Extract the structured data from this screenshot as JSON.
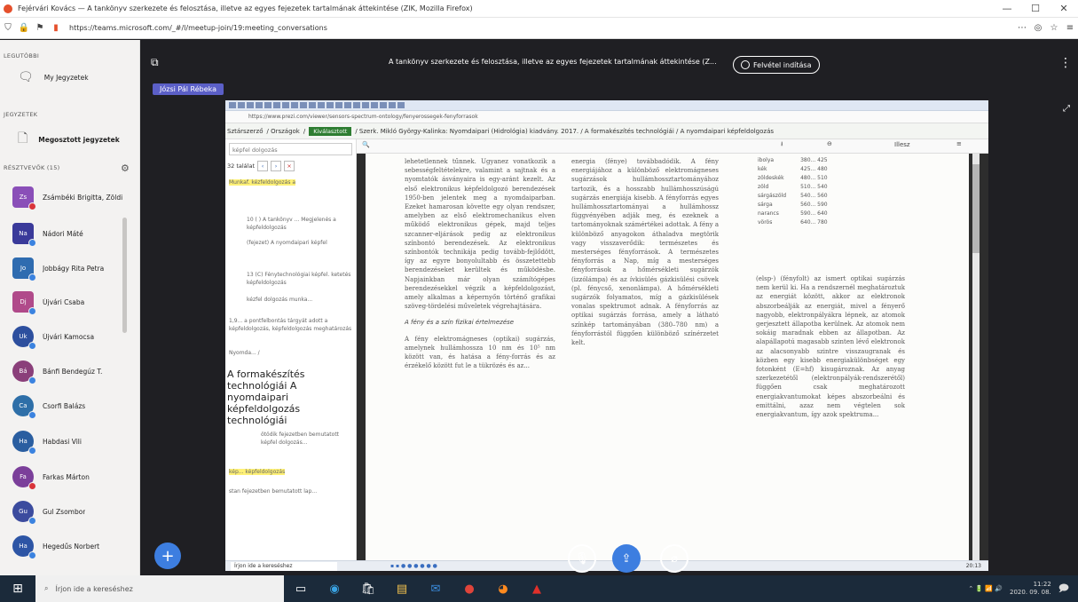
{
  "browser": {
    "window_title": "Fejérvári Kovács — A tankönyv szerkezete és felosztása, illetve az egyes fejezetek tartalmának áttekintése (ZIK, Mozilla Firefox)",
    "url": "https://teams.microsoft.com/_#/l/meetup-join/19:meeting_conversations",
    "controls": [
      "—",
      "☐",
      "✕"
    ]
  },
  "rail": {
    "section_recent": "LEGUTÓBBI",
    "item_recent": "My Jegyzetek",
    "section_meetings": "JEGYZETEK",
    "item_notes": "Megosztott jegyzetek",
    "section_participants": "RÉSZTVEVŐK (15)",
    "people": [
      {
        "initials": "Zs",
        "name": "Zsámbéki Brigitta, Zöldi",
        "color": "#8a4fb8",
        "square": true,
        "dot": "red"
      },
      {
        "initials": "Na",
        "name": "Nádori Máté",
        "color": "#3a3a9a",
        "square": true,
        "dot": "blue"
      },
      {
        "initials": "Jo",
        "name": "Jobbágy Rita Petra",
        "color": "#2f6cb0",
        "square": true,
        "dot": "blue"
      },
      {
        "initials": "Dj",
        "name": "Újvári Csaba",
        "color": "#b04a8a",
        "square": true,
        "dot": "blue"
      },
      {
        "initials": "Uk",
        "name": "Újvári Kamocsa",
        "color": "#2d4f9e",
        "square": false,
        "dot": "blue"
      },
      {
        "initials": "Bá",
        "name": "Bánfi Bendegúz T.",
        "color": "#8a3f7a",
        "square": false,
        "dot": "blue"
      },
      {
        "initials": "Ca",
        "name": "Csorfi Balázs",
        "color": "#2e6fa8",
        "square": false,
        "dot": "blue"
      },
      {
        "initials": "Ha",
        "name": "Habdasi Vili",
        "color": "#2a5ea0",
        "square": false,
        "dot": "blue"
      },
      {
        "initials": "Fa",
        "name": "Farkas Márton",
        "color": "#7b3f9a",
        "square": false,
        "dot": "red"
      },
      {
        "initials": "Gu",
        "name": "Gul Zsombor",
        "color": "#3b4b9e",
        "square": false,
        "dot": "blue"
      },
      {
        "initials": "Ha",
        "name": "Hegedűs Norbert",
        "color": "#2d55a5",
        "square": false,
        "dot": "blue"
      }
    ]
  },
  "meeting": {
    "title": "A tankönyv szerkezete és felosztása, illetve az egyes fejezetek tartalmának áttekintése (Z...",
    "record_label": "Felvétel indítása",
    "presenter": "Józsi Pál Rébeka",
    "menu_icon": "⋮"
  },
  "shared": {
    "tab_url": "https://www.prezi.com/viewer/sensors-spectrum-ontology/fenyerossegek-fenyforrasok",
    "crumbs": [
      "Sztárszerző",
      "/ Országok",
      "/",
      "Kiválasztott",
      "/ Szerk. Mikló György-Kalinka: Nyomdaipari (Hidrológia) kiadvány. 2017. / A formakészítés technológiái / A nyomdaipari képfeldolgozás"
    ],
    "search_placeholder": "képfel dolgozás",
    "side_count": "32 találat",
    "side_results": [
      "Munkaf. kézfeldolgozás a",
      "10 ( ) A tankönyv ... Megjelenés a képfeldolgozás",
      "(fejezet) A nyomdaipari képfel",
      "13 (C) Fénytechnológiai képfel. ketetés képfeldolgozás",
      "kézfel dolgozás munka...",
      "1,9... a pontfelbontás tárgyát adott a képfeldolgozás, képfeldolgozás meghatározás",
      "Nyomda... /"
    ],
    "side_big_title": "A formakészítés technológiái A nyomdaipari képfeldolgozás technológiái",
    "side_bottom": [
      "ötödik fejezetben bemutatott képfel dolgozás...",
      "kép... képfeldolgozás",
      "stan fejezetben bemutatott lap..."
    ],
    "doc_col1": "lehetetlennek tűnnek. Ugyanez vonatkozik a sebességfeltételekre, valamint a sajtnak és a nyomtatók ásványaira is egy-aránt kezelt. Az első elektronikus képfeldolgozó berendezések 1950-ben jelentek meg a nyomdaiparban. Ezeket hamarosan követte egy olyan rendszer, amelyben az első elektromechanikus elven működő elektronikus gépek, majd teljes szcanner-eljárások pedig az elektronikus színbontó berendezések. Az elektronikus színbontók technikája pedig tovább-fejlődött, így az egyre bonyolultabb és összetettebb berendezéseket kerültek és működésbe. Napjainkban már olyan számítógépes berendezésekkel végzik a képfeldolgozást, amely alkalmas a képernyőn történő grafikai szöveg-tördelési műveletek végrehajtására.",
    "doc_col1_heading": "A fény és a szín fizikai értelmezése",
    "doc_col1b": "A fény elektromágneses (optikai) sugárzás, amelynek hullámhossza 10 nm és 10⁵ nm között van, és hatása a fény-forrás és az érzékelő között fut le a tükrözés és az...",
    "doc_col2": "energia (fénye) továbbadódik. A fény energiájához a különböző elektromágneses sugárzások hullámhossztartományához tartozik, és a hosszabb hullámhosszúságú sugárzás energiája kisebb. A fényforrás egyes hullámhossztartományai a hullámhossz függvényében adják meg, és ezeknek a tartományoknak számértékei adottak. A fény a különböző anyagokon áthaladva megtörik vagy visszaverődik: természetes és mesterséges fényforrások. A természetes fényforrás a Nap, míg a mesterséges fényforrások a hőmérsékleti sugárzók (izzólámpa) és az ívkisülés gázkisülési csövek (pl. fénycső, xenonlámpa). A hőmérsékleti sugárzók folyamatos, míg a gázkisülések vonalas spektrumot adnak. A fényforrás az optikai sugárzás forrása, amely a látható színkép tartományában (380–780 nm) a fényforrástól függően különböző színérzetet kelt.",
    "doc_col3": "(elsp-) (fényfolt) az ismert optikai sugárzás nem kerül ki. Ha a rendszernél meghatároztuk az energiát között, akkor az elektronok abszorbeálják az energiát, mivel a fényerő nagyobb, elektronpályákra lépnek, az atomok gerjesztett állapotba kerülnek. Az atomok nem sokáig maradnak ebben az állapotban. Az alapállapotú magasabb szinten lévő elektronok az alacsonyabb szintre visszaugranak és közben egy kisebb energiakülönbséget egy fotonként (E=hf) kisugároznak. Az anyag szerkezetétől (elektronpályák-rendszerétől) függően csak meghatározott energiakvantumokat képes abszorbeálni és emittálni, azaz nem végtelen sok energiakvantum, így azok spektruma...",
    "wl_rows": [
      [
        "ibolya",
        "380... 425"
      ],
      [
        "kék",
        "425... 480"
      ],
      [
        "zöldeskék",
        "480... 510"
      ],
      [
        "zöld",
        "510... 540"
      ],
      [
        "sárgászöld",
        "540... 560"
      ],
      [
        "sárga",
        "560... 590"
      ],
      [
        "narancs",
        "590... 640"
      ],
      [
        "vörös",
        "640... 780"
      ]
    ],
    "toolbar_zoom": "Illesz",
    "taskbar_search": "Írjon ide a kereséshez",
    "taskbar_tray": "20:13"
  },
  "windows": {
    "search_placeholder": "Írjon ide a kereséshez",
    "tray_time": "11:22",
    "tray_date": "2020. 09. 08."
  },
  "colors": {
    "teams_purple": "#5b5fc7",
    "teams_blue": "#3d7ee0",
    "stage_bg": "#1f1f23",
    "rail_bg": "#f3f2f1"
  }
}
